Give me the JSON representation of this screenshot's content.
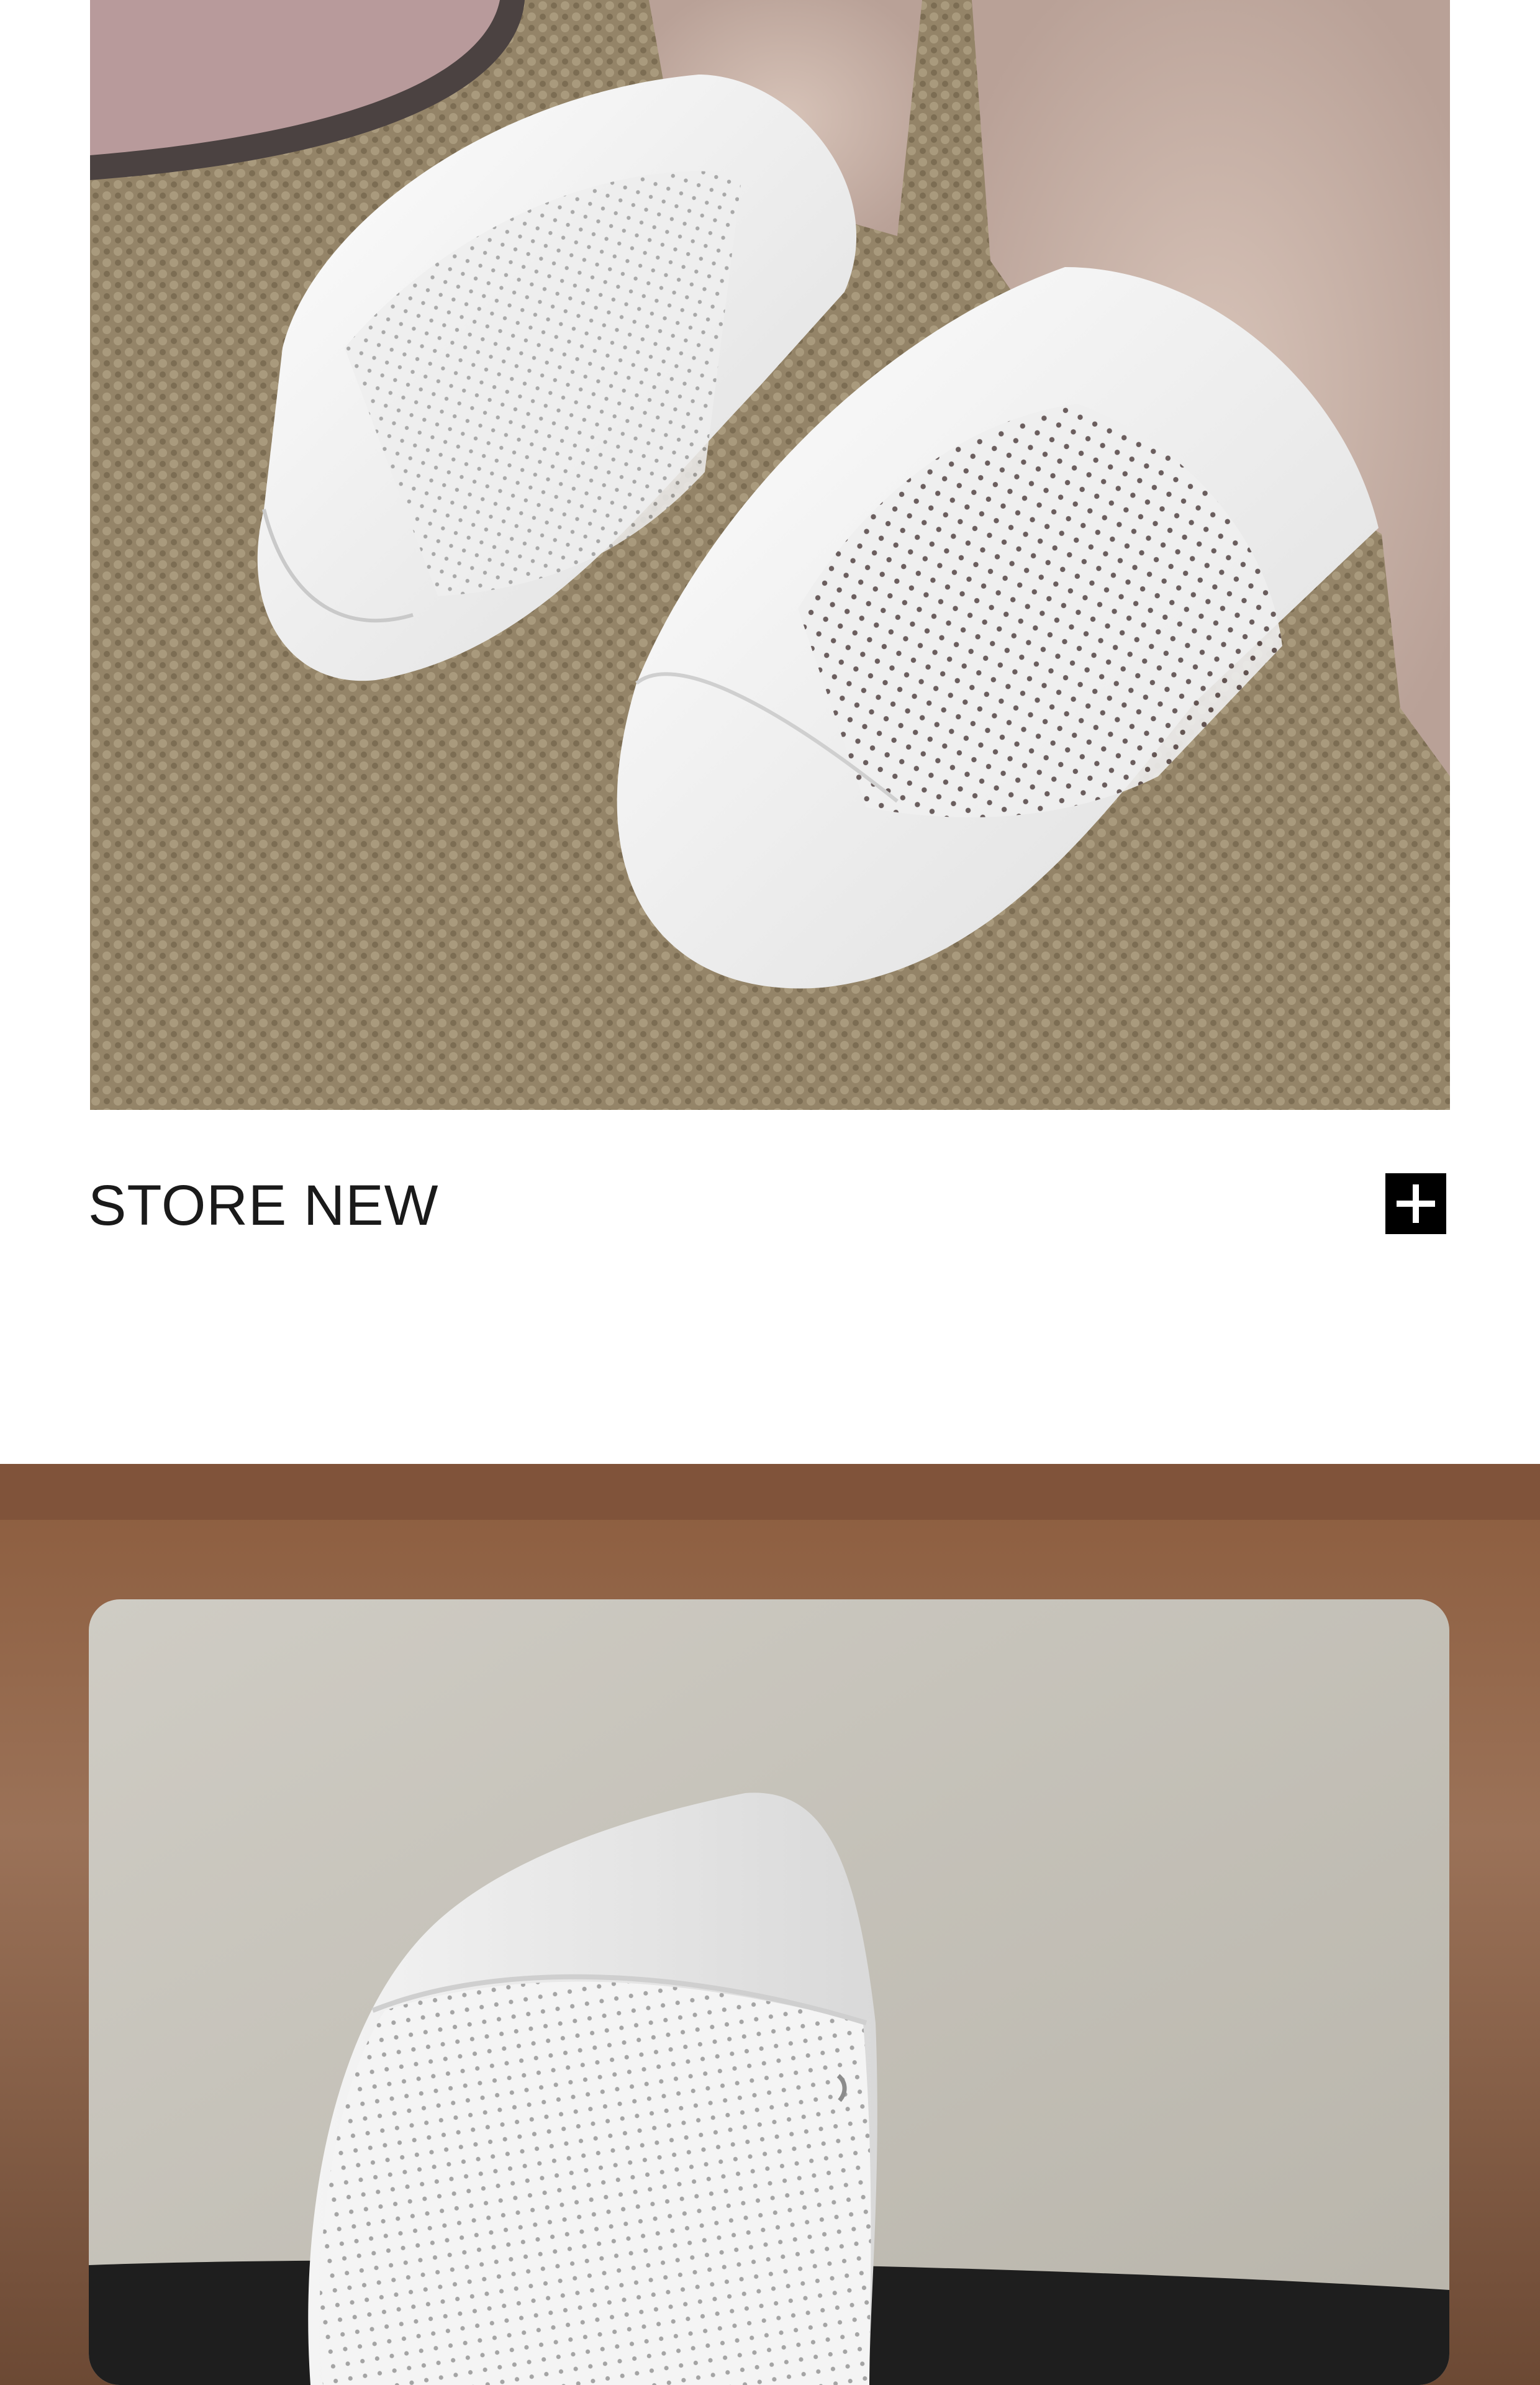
{
  "caption": {
    "title": "STORE NEW"
  },
  "icons": {
    "expand": "plus-icon"
  },
  "colors": {
    "background": "#ffffff",
    "text": "#1a1a1a",
    "button": "#000000"
  }
}
